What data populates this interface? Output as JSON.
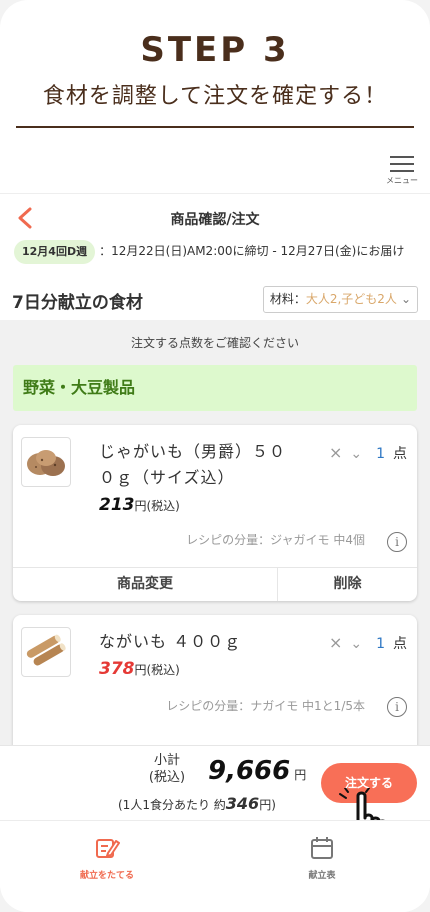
{
  "step": {
    "title": "STEP 3",
    "subtitle": "食材を調整して注文を確定する！"
  },
  "header": {
    "menu_label": "メニュー",
    "page_title": "商品確認/注文"
  },
  "delivery": {
    "week_badge": "12月4回D週",
    "schedule": "：12月22日(日)AM2:00に締切 - 12月27日(金)にお届け"
  },
  "menu_section": {
    "title": "7日分献立の食材",
    "servings_prefix": "材料：",
    "servings_value": "大人2,子ども2人"
  },
  "confirm_message": "注文する点数をご確認ください",
  "category": "野菜・大豆製品",
  "products": [
    {
      "name": "じゃがいも（男爵）５００ｇ（サイズ込）",
      "price": "213",
      "price_suffix": "円(税込)",
      "price_color": "#111111",
      "quantity": "1",
      "unit": "点",
      "recipe_amount": "レシピの分量：ジャガイモ 中4個",
      "change_label": "商品変更",
      "delete_label": "削除",
      "icon": "potato-icon"
    },
    {
      "name": "ながいも ４００ｇ",
      "price": "378",
      "price_suffix": "円(税込)",
      "price_color": "#e53935",
      "quantity": "1",
      "unit": "点",
      "recipe_amount": "レシピの分量：ナガイモ 中1と1/5本",
      "icon": "nagaimo-icon"
    }
  ],
  "summary": {
    "subtotal_label": "小計\n(税込)",
    "subtotal_amount": "9,666",
    "yen": "円",
    "per_person_prefix": "(1人1食分あたり 約",
    "per_person_amount": "346",
    "per_person_suffix": "円)",
    "order_button": "注文する"
  },
  "tabs": [
    {
      "label": "献立をたてる",
      "icon": "edit-icon",
      "active": true
    },
    {
      "label": "献立表",
      "icon": "calendar-icon",
      "active": false
    }
  ],
  "colors": {
    "accent": "#f86f57",
    "category_bg": "#ddf9cd",
    "category_text": "#3f7b17",
    "brown": "#4a2e1c",
    "quantity_blue": "#2f78c4"
  }
}
